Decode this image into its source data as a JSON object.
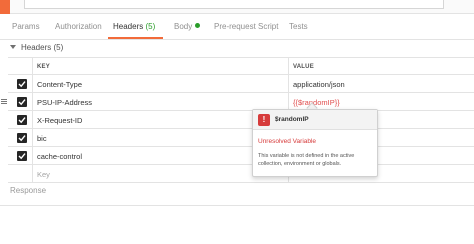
{
  "tabs": [
    {
      "label": "Params"
    },
    {
      "label": "Authorization"
    },
    {
      "label": "Headers",
      "count": "(5)"
    },
    {
      "label": "Body"
    },
    {
      "label": "Pre-request Script"
    },
    {
      "label": "Tests"
    }
  ],
  "headers_section": {
    "label": "Headers (5)"
  },
  "table": {
    "columns": {
      "key": "KEY",
      "value": "VALUE"
    },
    "rows": [
      {
        "key": "Content-Type",
        "value": "application/json",
        "checked": true
      },
      {
        "key": "PSU-IP-Address",
        "value": "{{$randomIP}}",
        "checked": true
      },
      {
        "key": "X-Request-ID",
        "value": "",
        "checked": true
      },
      {
        "key": "bic",
        "value": "",
        "checked": true
      },
      {
        "key": "cache-control",
        "value": "",
        "checked": true
      }
    ],
    "new_row": {
      "key_placeholder": "Key"
    }
  },
  "response": {
    "label": "Response"
  },
  "tooltip": {
    "icon": "!",
    "variable": "$randomIP",
    "status": "Unresolved Variable",
    "description": "This variable is not defined in the active collection, environment or globals."
  },
  "colors": {
    "accent": "#f26b3a",
    "error": "#d63b3b",
    "success": "#2a9d2a"
  }
}
